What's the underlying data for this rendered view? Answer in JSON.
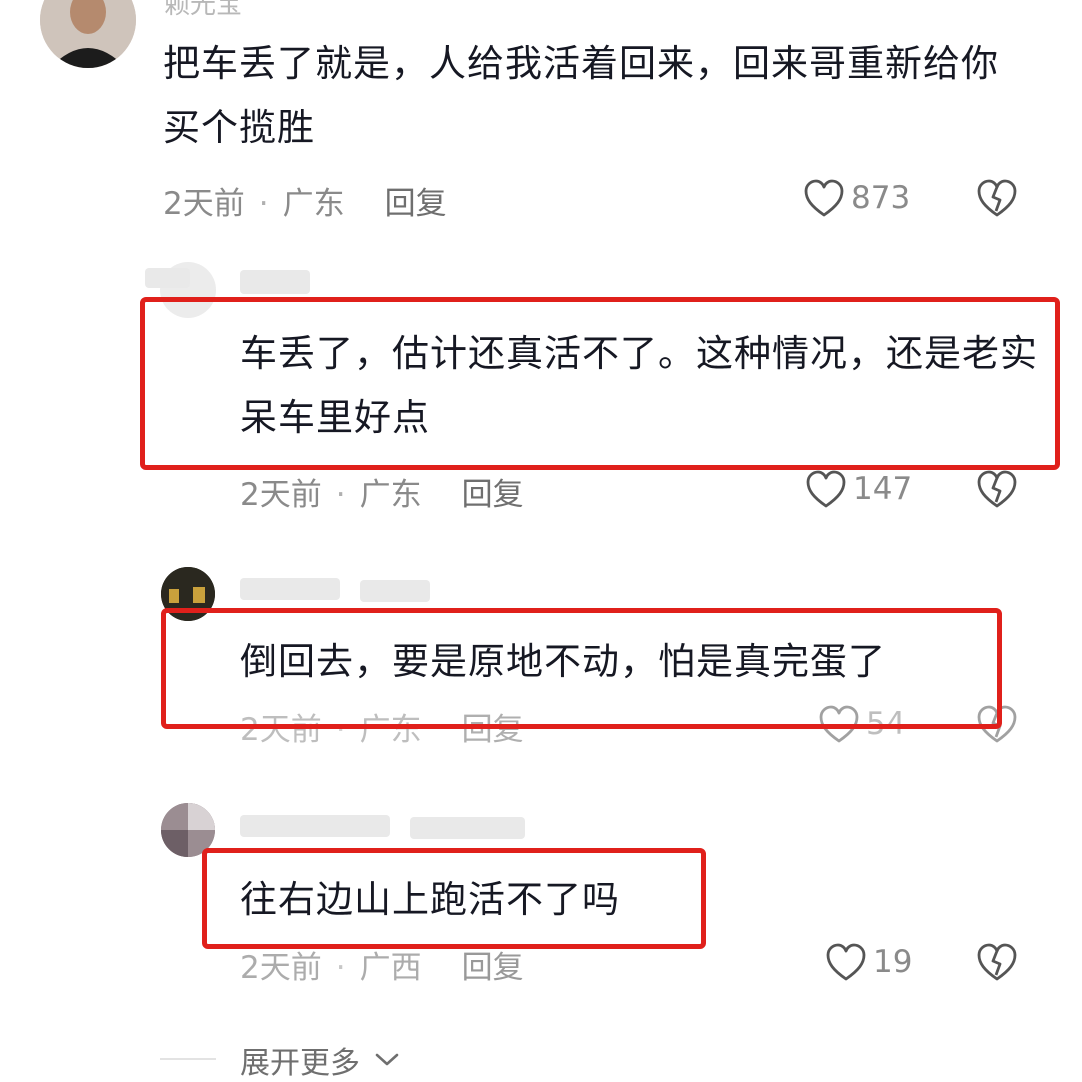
{
  "comments": [
    {
      "username": "赖光宝",
      "text": "把车丢了就是，人给我活着回来，回来哥重新给你买个揽胜",
      "time": "2天前",
      "location": "广东",
      "reply_label": "回复",
      "likes": "873"
    },
    {
      "text": "车丢了，估计还真活不了。这种情况，还是老实呆车里好点",
      "time": "2天前",
      "location": "广东",
      "reply_label": "回复",
      "likes": "147"
    },
    {
      "text": "倒回去，要是原地不动，怕是真完蛋了",
      "time": "2天前",
      "location": "广东",
      "reply_label": "回复",
      "likes": "54"
    },
    {
      "text": "往右边山上跑活不了吗",
      "time": "2天前",
      "location": "广西",
      "reply_label": "回复",
      "likes": "19"
    }
  ],
  "expand_label": "展开更多",
  "colors": {
    "highlight_box": "#e0201b",
    "meta_text": "#8a8a8a",
    "body_text": "#161823"
  },
  "icons": [
    "heart-icon",
    "broken-heart-icon",
    "chevron-down-icon"
  ]
}
